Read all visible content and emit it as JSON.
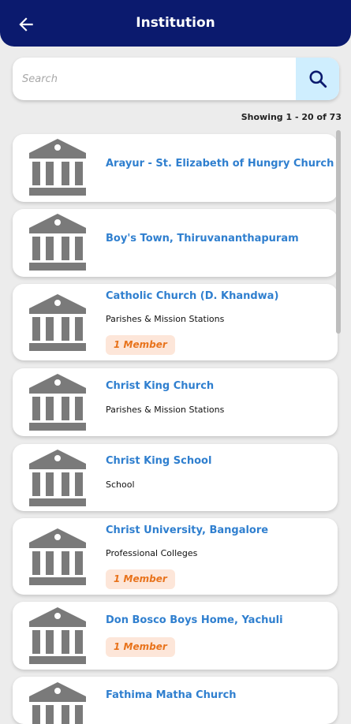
{
  "header": {
    "title": "Institution"
  },
  "search": {
    "placeholder": "Search"
  },
  "pagination": {
    "showing_text": "Showing 1 - 20 of 73"
  },
  "institutions": [
    {
      "name": "Arayur - St. Elizabeth of Hungry Church",
      "category": "",
      "members": ""
    },
    {
      "name": "Boy's Town, Thiruvananthapuram",
      "category": "",
      "members": ""
    },
    {
      "name": "Catholic Church (D. Khandwa)",
      "category": "Parishes & Mission Stations",
      "members": "1 Member"
    },
    {
      "name": "Christ King Church",
      "category": "Parishes & Mission Stations",
      "members": ""
    },
    {
      "name": "Christ King School",
      "category": "School",
      "members": ""
    },
    {
      "name": "Christ University, Bangalore",
      "category": "Professional Colleges",
      "members": "1 Member"
    },
    {
      "name": "Don Bosco Boys Home, Yachuli",
      "category": "",
      "members": "1 Member"
    },
    {
      "name": "Fathima Matha Church",
      "category": "",
      "members": ""
    }
  ],
  "colors": {
    "appbar": "#0b1a6e",
    "link": "#2f7fcf",
    "badge_bg": "#fde6d9",
    "badge_text": "#e8731c",
    "search_button": "#cfeefe",
    "icon": "#7a7a7a"
  }
}
